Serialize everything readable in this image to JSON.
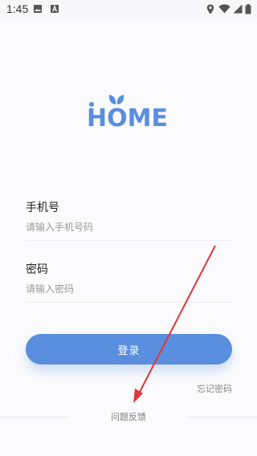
{
  "status_bar": {
    "time": "1:45",
    "icons": [
      "image-icon",
      "font-icon",
      "location-icon",
      "wifi-icon",
      "signal-icon",
      "battery-icon"
    ]
  },
  "logo": {
    "text": "HOME",
    "color": "#5a8fe0",
    "leaf_color": "#5a8fe0"
  },
  "form": {
    "phone": {
      "label": "手机号",
      "placeholder": "请输入手机号码",
      "value": ""
    },
    "password": {
      "label": "密码",
      "placeholder": "请输入密码",
      "value": ""
    }
  },
  "login_button": {
    "label": "登录",
    "color": "#5a8fe0"
  },
  "forgot_password": "忘记密码",
  "feedback": "问题反馈",
  "annotation_arrow": {
    "color": "#e0353b"
  }
}
